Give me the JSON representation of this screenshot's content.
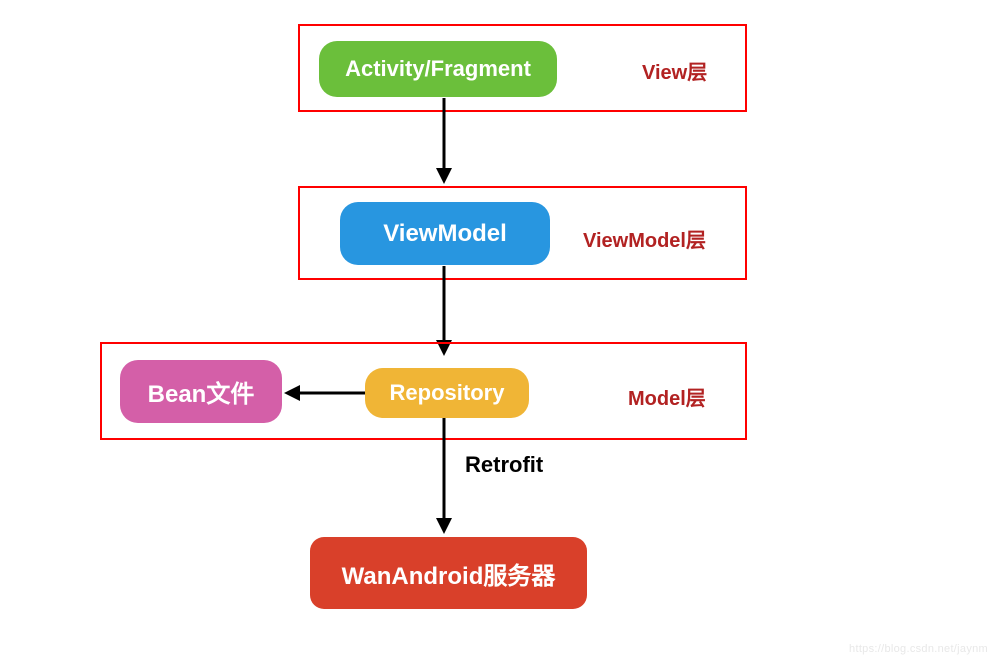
{
  "layers": {
    "view": {
      "label": "View层"
    },
    "viewmodel": {
      "label": "ViewModel层"
    },
    "model": {
      "label": "Model层"
    }
  },
  "nodes": {
    "activity_fragment": {
      "text": "Activity/Fragment",
      "color": "#6bbf3b"
    },
    "viewmodel": {
      "text": "ViewModel",
      "color": "#2896e0"
    },
    "bean": {
      "text": "Bean文件",
      "color": "#d45fa8"
    },
    "repository": {
      "text": "Repository",
      "color": "#f0b536"
    },
    "server": {
      "text": "WanAndroid服务器",
      "color": "#d9402a"
    }
  },
  "edges": {
    "retrofit": {
      "label": "Retrofit"
    }
  },
  "watermark": "https://blog.csdn.net/jaynm"
}
